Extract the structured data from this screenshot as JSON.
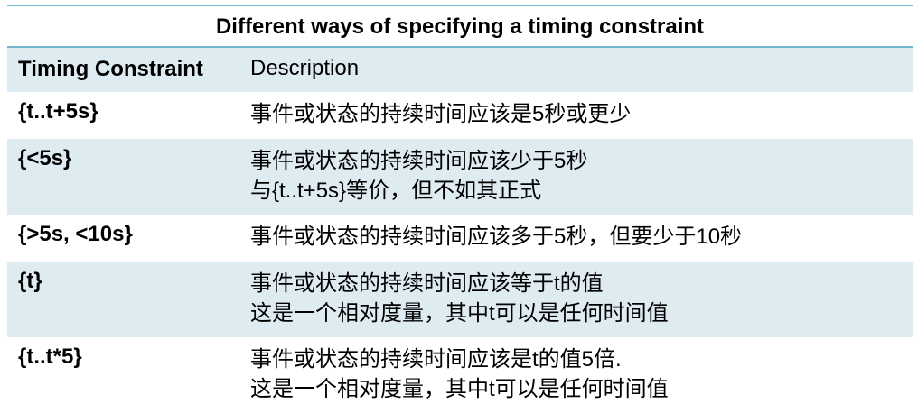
{
  "title": "Different ways of specifying a timing constraint",
  "headers": {
    "constraint": "Timing Constraint",
    "description": "Description"
  },
  "rows": [
    {
      "constraint": "{t..t+5s}",
      "lines": [
        "事件或状态的持续时间应该是5秒或更少"
      ]
    },
    {
      "constraint": "{<5s}",
      "lines": [
        "事件或状态的持续时间应该少于5秒",
        "与{t..t+5s}等价，但不如其正式"
      ]
    },
    {
      "constraint": "{>5s, <10s}",
      "lines": [
        "事件或状态的持续时间应该多于5秒，但要少于10秒"
      ]
    },
    {
      "constraint": "{t}",
      "lines": [
        "事件或状态的持续时间应该等于t的值",
        "这是一个相对度量，其中t可以是任何时间值"
      ]
    },
    {
      "constraint": "{t..t*5}",
      "lines": [
        "事件或状态的持续时间应该是t的值5倍.",
        "这是一个相对度量，其中t可以是任何时间值"
      ]
    }
  ]
}
